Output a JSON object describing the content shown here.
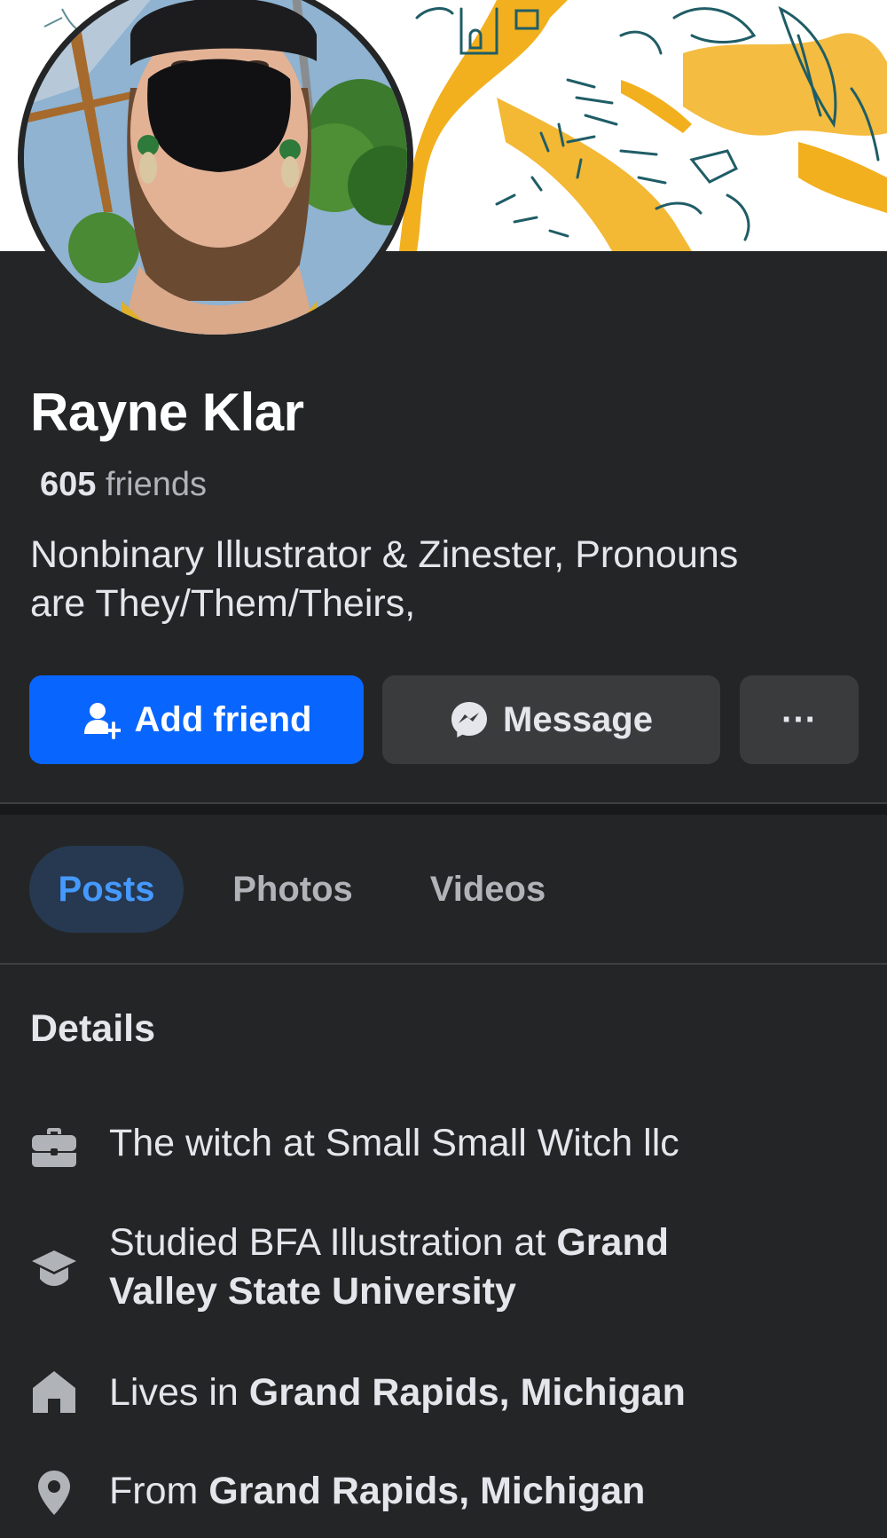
{
  "profile": {
    "name": "Rayne Klar",
    "friends_count": "605",
    "friends_label": " friends",
    "bio_line1": "Nonbinary Illustrator & Zinester, Pronouns",
    "bio_line2": "are They/Them/Theirs,"
  },
  "actions": {
    "add_friend": "Add friend",
    "message": "Message",
    "more": "···"
  },
  "tabs": [
    {
      "label": "Posts",
      "active": true
    },
    {
      "label": "Photos",
      "active": false
    },
    {
      "label": "Videos",
      "active": false
    }
  ],
  "details": {
    "title": "Details",
    "work": {
      "text": "The witch at Small Small Witch llc"
    },
    "education": {
      "prefix": "Studied BFA Illustration at ",
      "school_line1": "Grand",
      "school_line2": "Valley State University"
    },
    "lives": {
      "prefix": "Lives in ",
      "place": "Grand Rapids, Michigan"
    },
    "from": {
      "prefix": "From ",
      "place": "Grand Rapids, Michigan"
    }
  },
  "colors": {
    "background": "#242526",
    "primary_button": "#0866ff",
    "secondary_button": "#3a3b3c",
    "active_tab_bg": "#263951",
    "active_tab_text": "#4599ff",
    "cover_accent": "#f2b01e",
    "cover_ink": "#1f5d66"
  },
  "icons": {
    "add_friend": "person-plus-icon",
    "message": "messenger-icon",
    "work": "briefcase-icon",
    "education": "graduation-cap-icon",
    "lives": "house-icon",
    "from": "map-pin-icon"
  }
}
